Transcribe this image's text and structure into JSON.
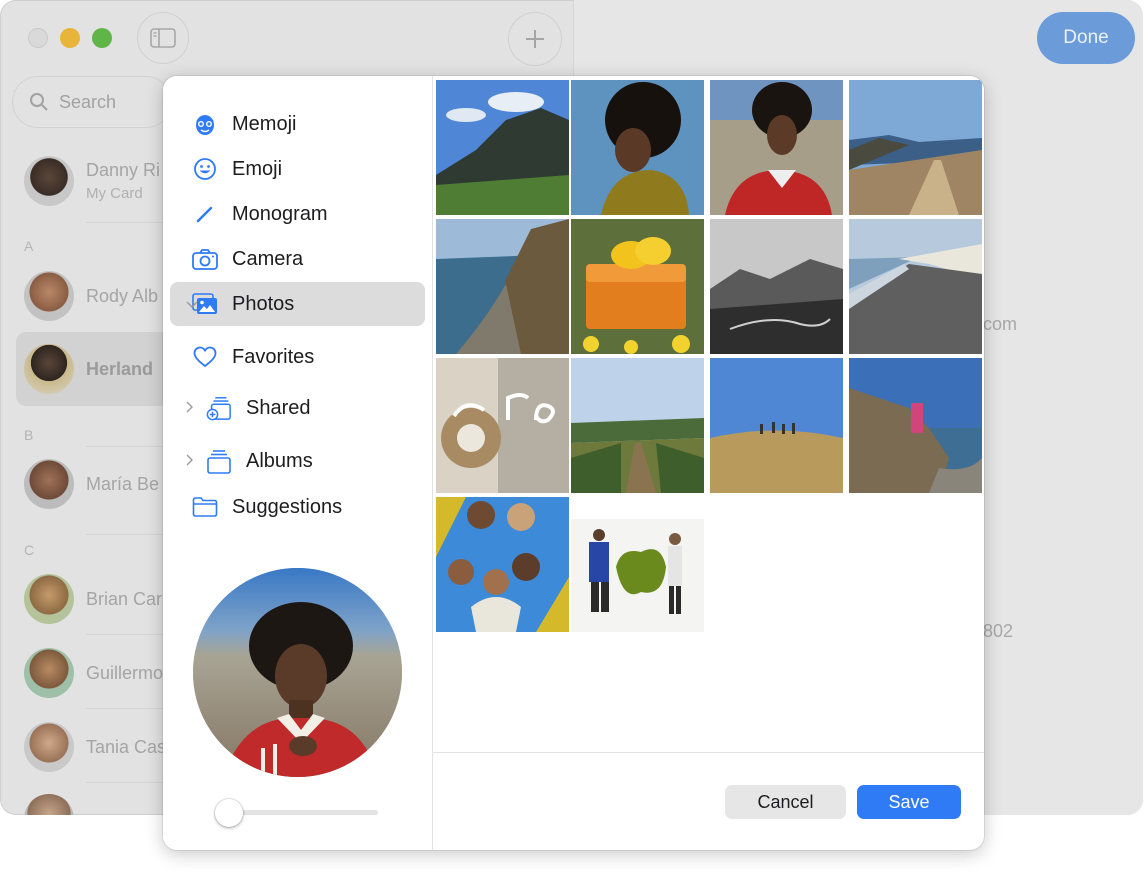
{
  "window": {
    "done_label": "Done",
    "search_placeholder": "Search",
    "my_card": {
      "name": "Danny Ri",
      "subtitle": "My Card"
    },
    "sections": [
      "A",
      "B",
      "C"
    ],
    "contacts": [
      {
        "name": "Rody Alb"
      },
      {
        "name": "Herland"
      },
      {
        "name": "María Be"
      },
      {
        "name": "Brian Car"
      },
      {
        "name": "Guillermo"
      },
      {
        "name": "Tania Cas"
      }
    ],
    "right_fragments": [
      "com",
      "802"
    ]
  },
  "modal": {
    "menu": [
      {
        "label": "Memoji",
        "icon": "memoji-icon"
      },
      {
        "label": "Emoji",
        "icon": "smiley-icon"
      },
      {
        "label": "Monogram",
        "icon": "pencil-icon"
      },
      {
        "label": "Camera",
        "icon": "camera-icon"
      },
      {
        "label": "Photos",
        "icon": "photos-icon",
        "selected": true,
        "expanded": true
      },
      {
        "label": "Favorites",
        "icon": "heart-icon"
      },
      {
        "label": "Shared",
        "icon": "shared-album-icon",
        "collapsed": true
      },
      {
        "label": "Albums",
        "icon": "albums-icon",
        "collapsed": true
      },
      {
        "label": "Suggestions",
        "icon": "folder-icon"
      }
    ],
    "photos": [
      "mountain-landscape",
      "portrait-yellow-sweater",
      "portrait-red-sweater",
      "coastal-trail",
      "sea-cliffs",
      "lemons-on-orange-box",
      "misty-valley",
      "pebble-beach-cliffs",
      "era-book-cover",
      "vineyard-path",
      "people-on-hill",
      "woman-on-rocks",
      "group-looking-down",
      "sculpture-couple"
    ],
    "cancel_label": "Cancel",
    "save_label": "Save",
    "colors": {
      "accent": "#2f7bf5",
      "icon_blue": "#2f7bf5",
      "selected_bg": "#dcdcdc"
    }
  }
}
